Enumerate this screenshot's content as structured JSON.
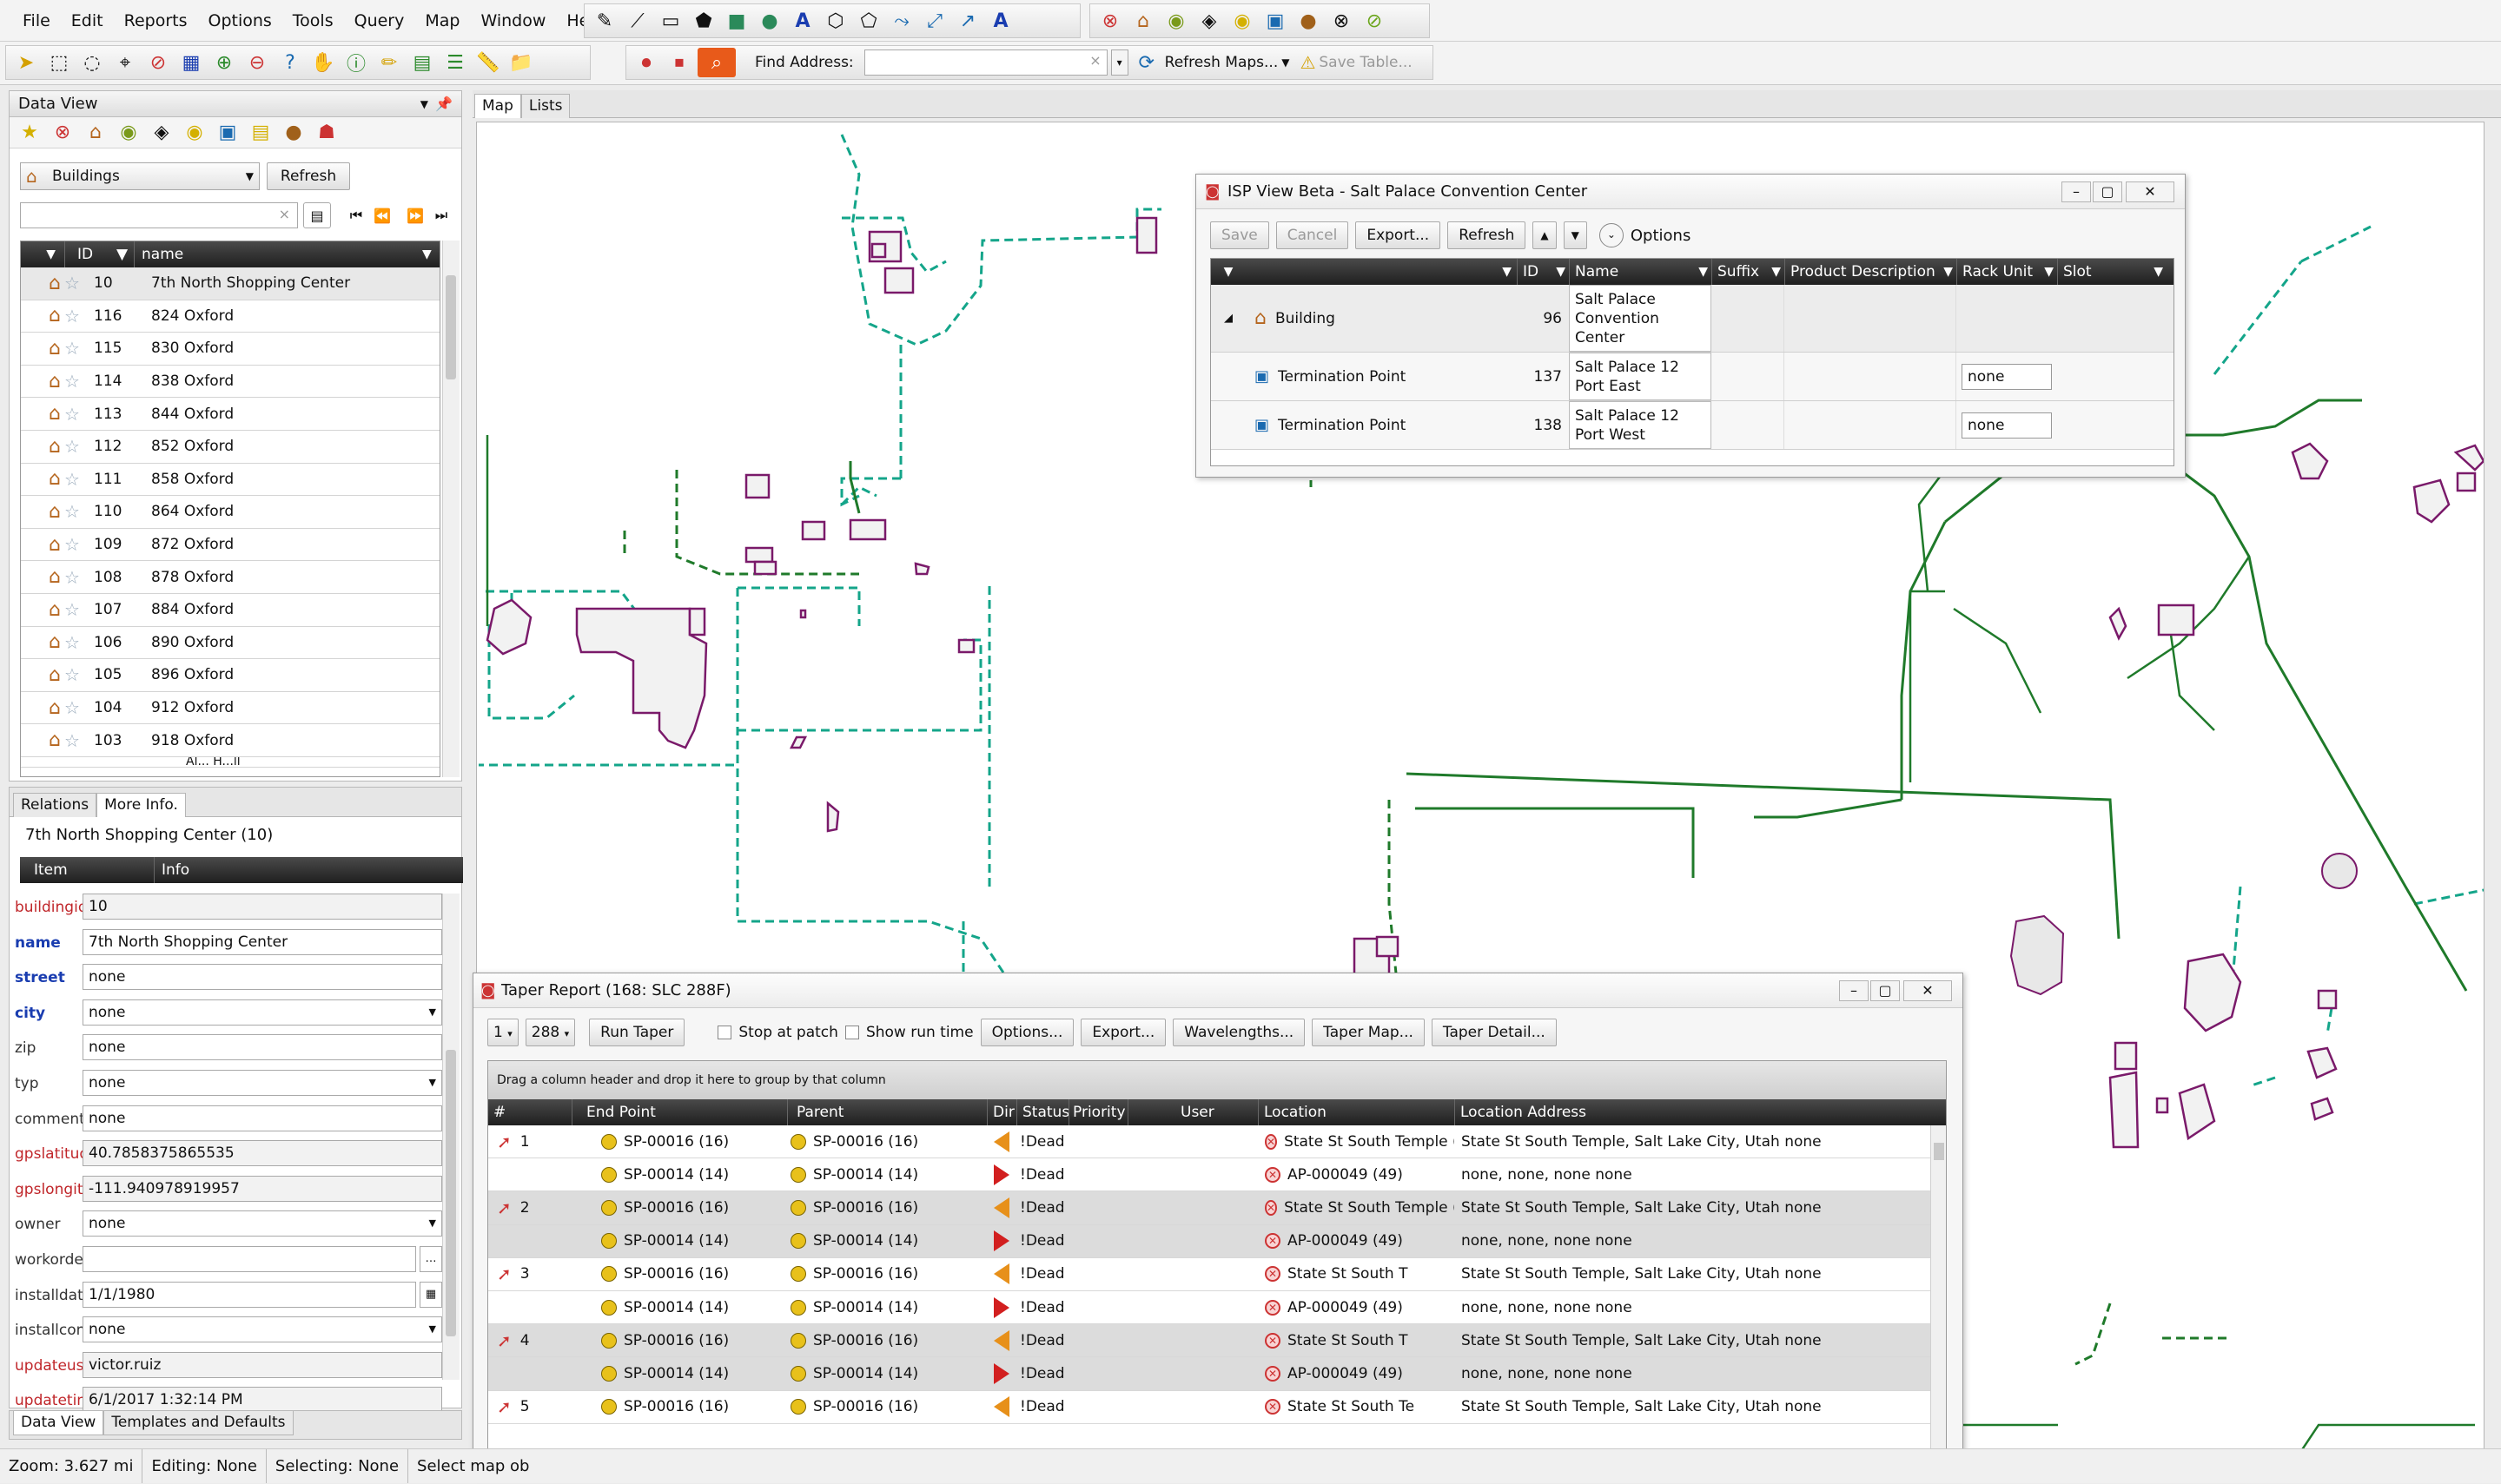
{
  "menu": {
    "items": [
      "File",
      "Edit",
      "Reports",
      "Options",
      "Tools",
      "Query",
      "Map",
      "Window",
      "Help"
    ]
  },
  "toolbar": {
    "find_address_label": "Find Address:",
    "find_address_value": "",
    "refresh_maps_label": "Refresh Maps...",
    "save_table_label": "Save Table..."
  },
  "data_view": {
    "title": "Data View",
    "layer_select": "Buildings",
    "refresh_label": "Refresh",
    "columns": {
      "id": "ID",
      "name": "name"
    },
    "rows": [
      {
        "id": "10",
        "name": "7th North Shopping Center"
      },
      {
        "id": "116",
        "name": "824 Oxford"
      },
      {
        "id": "115",
        "name": "830 Oxford"
      },
      {
        "id": "114",
        "name": "838 Oxford"
      },
      {
        "id": "113",
        "name": "844 Oxford"
      },
      {
        "id": "112",
        "name": "852 Oxford"
      },
      {
        "id": "111",
        "name": "858 Oxford"
      },
      {
        "id": "110",
        "name": "864 Oxford"
      },
      {
        "id": "109",
        "name": "872 Oxford"
      },
      {
        "id": "108",
        "name": "878 Oxford"
      },
      {
        "id": "107",
        "name": "884 Oxford"
      },
      {
        "id": "106",
        "name": "890 Oxford"
      },
      {
        "id": "105",
        "name": "896 Oxford"
      },
      {
        "id": "104",
        "name": "912 Oxford"
      },
      {
        "id": "103",
        "name": "918 Oxford"
      }
    ],
    "partial_row": "Al...       H...ll"
  },
  "info_panel": {
    "tab_relations": "Relations",
    "tab_more_info": "More Info.",
    "selected_title": "7th North Shopping Center  (10)",
    "col_item": "Item",
    "col_info": "Info",
    "attributes": [
      {
        "label": "buildingid",
        "value": "10",
        "style": "red",
        "kind": "ro"
      },
      {
        "label": "name",
        "value": "7th North Shopping Center",
        "style": "blue",
        "kind": "text"
      },
      {
        "label": "street",
        "value": "none",
        "style": "blue",
        "kind": "text"
      },
      {
        "label": "city",
        "value": "none",
        "style": "blue",
        "kind": "select"
      },
      {
        "label": "zip",
        "value": "none",
        "style": "gray",
        "kind": "text"
      },
      {
        "label": "typ",
        "value": "none",
        "style": "gray",
        "kind": "select"
      },
      {
        "label": "comments",
        "value": "none",
        "style": "gray",
        "kind": "text"
      },
      {
        "label": "gpslatitude",
        "value": "40.7858375865535",
        "style": "red",
        "kind": "ro"
      },
      {
        "label": "gpslongitude",
        "value": "-111.940978919957",
        "style": "red",
        "kind": "ro"
      },
      {
        "label": "owner",
        "value": "none",
        "style": "gray",
        "kind": "select"
      },
      {
        "label": "workorderid",
        "value": "",
        "style": "gray",
        "kind": "lookup"
      },
      {
        "label": "installdate",
        "value": "1/1/1980",
        "style": "gray",
        "kind": "date"
      },
      {
        "label": "installcompany",
        "value": "none",
        "style": "gray",
        "kind": "select"
      },
      {
        "label": "updateuser",
        "value": "victor.ruiz",
        "style": "red",
        "kind": "ro"
      },
      {
        "label": "updatetime",
        "value": "6/1/2017 1:32:14 PM",
        "style": "red",
        "kind": "ro"
      }
    ],
    "bottom_tab_data_view": "Data View",
    "bottom_tab_templates": "Templates and Defaults"
  },
  "map_tabs": {
    "map": "Map",
    "lists": "Lists"
  },
  "isp_view": {
    "title": "ISP View Beta - Salt Palace Convention Center",
    "buttons": {
      "save": "Save",
      "cancel": "Cancel",
      "export": "Export...",
      "refresh": "Refresh",
      "options": "Options"
    },
    "columns": {
      "id": "ID",
      "name": "Name",
      "suffix": "Suffix",
      "product": "Product Description",
      "rack": "Rack Unit",
      "slot": "Slot"
    },
    "rows": [
      {
        "type": "Building",
        "id": "96",
        "name_l1": "Salt      Palace",
        "name_l2": "Convention",
        "name_l3": "Center",
        "rack": ""
      },
      {
        "type": "Termination Point",
        "id": "137",
        "name_l1": "Salt    Palace    12",
        "name_l2": "Port East",
        "name_l3": "",
        "rack": "none"
      },
      {
        "type": "Termination Point",
        "id": "138",
        "name_l1": "Salt    Palace    12",
        "name_l2": "Port West",
        "name_l3": "",
        "rack": "none"
      }
    ]
  },
  "taper": {
    "title": "Taper Report (168: SLC 288F)",
    "sel1": "1",
    "sel2": "288",
    "run_taper": "Run Taper",
    "stop_at_patch": "Stop at patch",
    "show_run_time": "Show run time",
    "buttons": [
      "Options...",
      "Export...",
      "Wavelengths...",
      "Taper Map...",
      "Taper Detail..."
    ],
    "group_hint": "Drag a column header and drop it here to group by that column",
    "columns": {
      "num": "#",
      "end": "End Point",
      "parent": "Parent",
      "dir": "Dir",
      "status": "Status",
      "priority": "Priority",
      "user": "User",
      "location": "Location",
      "address": "Location Address"
    },
    "rows": [
      {
        "num": "1",
        "end": "SP-00016 (16)",
        "parent": "SP-00016 (16)",
        "dir": "left",
        "status": "!Dead",
        "location": "State St South Temple (",
        "address": "State St South Temple, Salt Lake City, Utah  none",
        "shade": false
      },
      {
        "num": "",
        "end": "SP-00014 (14)",
        "parent": "SP-00014 (14)",
        "dir": "right",
        "status": "!Dead",
        "location": "AP-000049 (49)",
        "address": "none, none, none  none",
        "shade": false
      },
      {
        "num": "2",
        "end": "SP-00016 (16)",
        "parent": "SP-00016 (16)",
        "dir": "left",
        "status": "!Dead",
        "location": "State St South Temple (",
        "address": "State St South Temple, Salt Lake City, Utah  none",
        "shade": true
      },
      {
        "num": "",
        "end": "SP-00014 (14)",
        "parent": "SP-00014 (14)",
        "dir": "right",
        "status": "!Dead",
        "location": "AP-000049 (49)",
        "address": "none, none, none  none",
        "shade": true
      },
      {
        "num": "3",
        "end": "SP-00016 (16)",
        "parent": "SP-00016 (16)",
        "dir": "left",
        "status": "!Dead",
        "location": "State St South T",
        "address": "State St South Temple, Salt Lake City, Utah  none",
        "shade": false
      },
      {
        "num": "",
        "end": "SP-00014 (14)",
        "parent": "SP-00014 (14)",
        "dir": "right",
        "status": "!Dead",
        "location": "AP-000049 (49)",
        "address": "none, none, none  none",
        "shade": false
      },
      {
        "num": "4",
        "end": "SP-00016 (16)",
        "parent": "SP-00016 (16)",
        "dir": "left",
        "status": "!Dead",
        "location": "State St South T",
        "address": "State St South Temple, Salt Lake City, Utah  none",
        "shade": true
      },
      {
        "num": "",
        "end": "SP-00014 (14)",
        "parent": "SP-00014 (14)",
        "dir": "right",
        "status": "!Dead",
        "location": "AP-000049 (49)",
        "address": "none, none, none  none",
        "shade": true
      },
      {
        "num": "5",
        "end": "SP-00016 (16)",
        "parent": "SP-00016 (16)",
        "dir": "left",
        "status": "!Dead",
        "location": "State St South Te",
        "address": "State St South Temple, Salt Lake City, Utah  none",
        "shade": false
      }
    ]
  },
  "status_bar": {
    "zoom": "Zoom: 3.627 mi",
    "editing": "Editing: None",
    "selecting": "Selecting: None",
    "hint": "Select map ob"
  },
  "colors": {
    "fiber_teal": "#14a58a",
    "fiber_green": "#1f7a2a",
    "building_outline": "#7a1a6a",
    "accent_blue": "#1a3db0",
    "label_red": "#c0262a"
  }
}
